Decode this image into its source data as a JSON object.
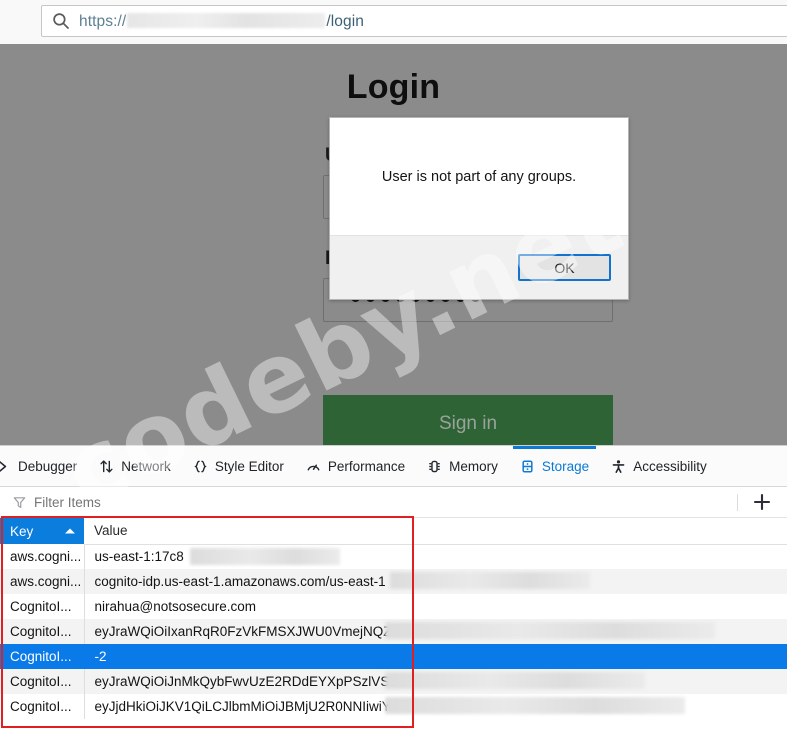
{
  "browser": {
    "url_scheme": "https://",
    "url_path": "/login",
    "url_redacted": true,
    "search_icon": "search-icon"
  },
  "page": {
    "title": "Login",
    "username_label": "U",
    "password_label": "P",
    "password_dots": 9,
    "signin_label": "Sign in",
    "signin_color": "#2e6335",
    "overlay_color": "#8b8b8b"
  },
  "watermark": {
    "text": "codeby.net"
  },
  "dialog": {
    "message": "User is not part of any groups.",
    "ok_label": "OK",
    "focus_color": "#1272cf"
  },
  "devtools": {
    "tabs": [
      {
        "label": "Debugger",
        "icon": "debugger-icon",
        "active": false
      },
      {
        "label": "Network",
        "icon": "network-icon",
        "active": false
      },
      {
        "label": "Style Editor",
        "icon": "style-editor-icon",
        "active": false
      },
      {
        "label": "Performance",
        "icon": "performance-icon",
        "active": false
      },
      {
        "label": "Memory",
        "icon": "memory-icon",
        "active": false
      },
      {
        "label": "Storage",
        "icon": "storage-icon",
        "active": true
      },
      {
        "label": "Accessibility",
        "icon": "accessibility-icon",
        "active": false
      }
    ],
    "active_tab": "Storage",
    "active_color": "#0b79d5",
    "filter": {
      "placeholder": "Filter Items",
      "value": "",
      "icon": "filter-icon"
    },
    "add_button": "+",
    "table": {
      "columns": [
        "Key",
        "Value"
      ],
      "sort_column": "Key",
      "sort_direction": "ascending",
      "header_highlight_color": "#0b7ddd",
      "selection_color": "#0a7ae8",
      "rows": [
        {
          "key": "aws.cogni...",
          "value": "us-east-1:17c8",
          "redacted_tail": true,
          "selected": false
        },
        {
          "key": "aws.cogni...",
          "value": "cognito-idp.us-east-1.amazonaws.com/us-east-1",
          "redacted_tail": true,
          "selected": false
        },
        {
          "key": "CognitoI...",
          "value": "nirahua@notsosecure.com",
          "redacted_tail": false,
          "selected": false
        },
        {
          "key": "CognitoI...",
          "value": "eyJraWQiOiIxanRqR0FzVkFMSXJWU0VmejNQZHI",
          "redacted_tail": true,
          "selected": false
        },
        {
          "key": "CognitoI...",
          "value": "-2",
          "redacted_tail": false,
          "selected": true
        },
        {
          "key": "CognitoI...",
          "value": "eyJraWQiOiJnMkQybFwvUzE2RDdEYXpPSzlVSzC",
          "redacted_tail": true,
          "selected": false
        },
        {
          "key": "CognitoI...",
          "value": "eyJjdHkiOiJKV1QiLCJlbmMiOiJBMjU2R0NNIiwiY",
          "redacted_tail": true,
          "selected": false
        }
      ]
    },
    "highlight_box_color": "#e02020"
  }
}
